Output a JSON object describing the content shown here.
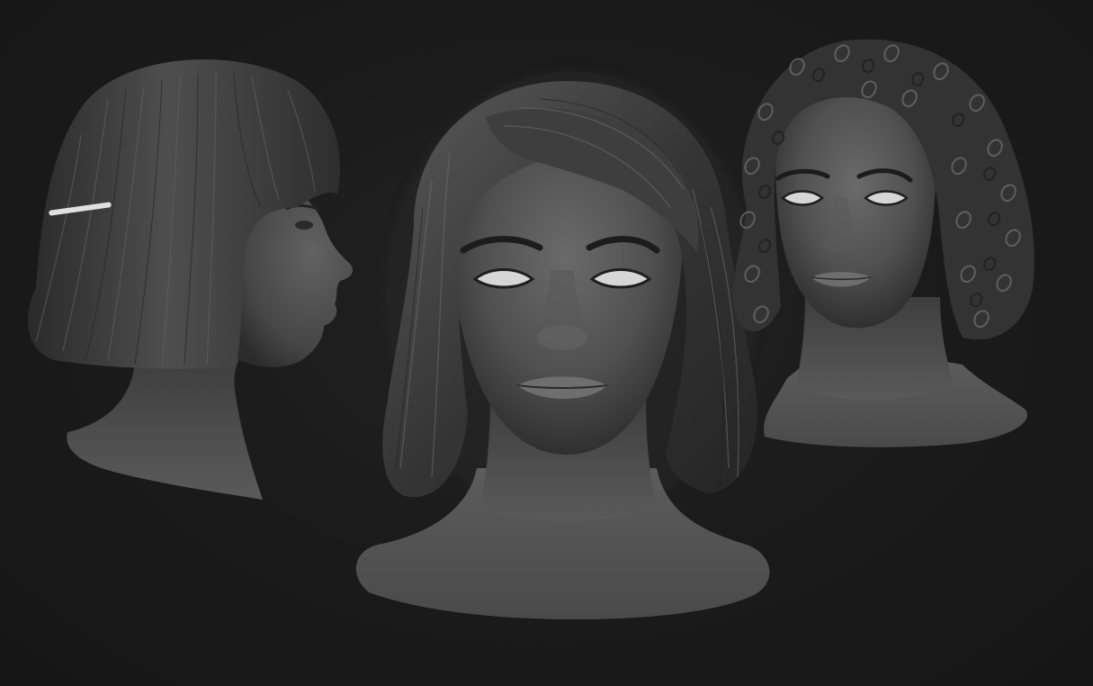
{
  "scene": {
    "background_color": "#181818",
    "sculpt_color": "#5a5a5a",
    "hair_color": "#3c3c3c",
    "eye_color": "#d6d6d6",
    "hair_clip_color": "#e0e0e0",
    "views": [
      {
        "name": "profile-right",
        "hair_style": "straight bob with bangs",
        "accessory": "hair clip"
      },
      {
        "name": "front",
        "hair_style": "wavy shoulder-length bob with side-swept bangs"
      },
      {
        "name": "three-quarter",
        "hair_style": "curly shoulder-length"
      }
    ]
  }
}
